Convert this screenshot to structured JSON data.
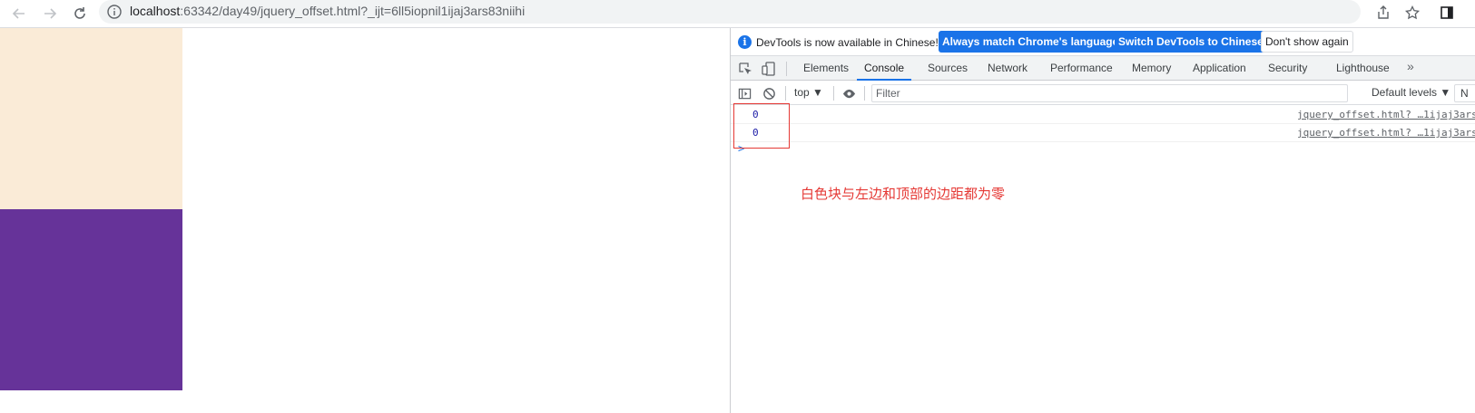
{
  "browser": {
    "url_host": "localhost",
    "url_path": ":63342/day49/jquery_offset.html?_ijt=6ll5iopnil1ijaj3ars83niihi"
  },
  "page": {
    "block_top_color": "#faebd7",
    "block_bottom_color": "#663399"
  },
  "devtools": {
    "infobar": {
      "message": "DevTools is now available in Chinese!",
      "btn_match": "Always match Chrome's language",
      "btn_switch": "Switch DevTools to Chinese",
      "btn_dismiss": "Don't show again"
    },
    "tabs": [
      "Elements",
      "Console",
      "Sources",
      "Network",
      "Performance",
      "Memory",
      "Application",
      "Security",
      "Lighthouse"
    ],
    "active_tab": "Console",
    "more_tabs": "»",
    "toolbar": {
      "context": "top ▼",
      "filter_placeholder": "Filter",
      "levels": "Default levels ▼",
      "trailing": "N"
    },
    "logs": [
      {
        "value": "0",
        "source": "jquery_offset.html? …1ijaj3ars"
      },
      {
        "value": "0",
        "source": "jquery_offset.html? …1ijaj3ars"
      }
    ],
    "prompt": ">"
  },
  "annotation": "白色块与左边和顶部的边距都为零",
  "colors": {
    "accent": "#1a73e8",
    "annotation_red": "#e53935"
  }
}
